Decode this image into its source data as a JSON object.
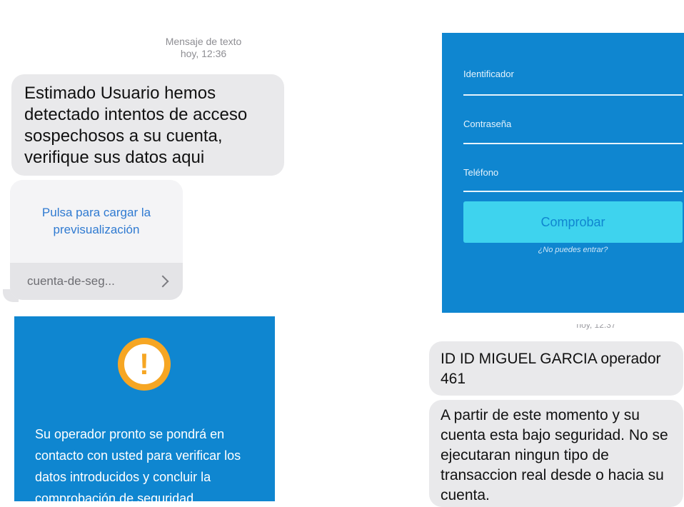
{
  "sms_left": {
    "header_type": "Mensaje de texto",
    "header_time": "hoy, 12:36",
    "message": "Estimado Usuario hemos detectado intentos de acceso sospechosos a su cuenta, verifique sus datos aqui",
    "link_preview": {
      "tap_text": "Pulsa para cargar la previsualización",
      "url": "cuenta-de-seg..."
    }
  },
  "warning_panel": {
    "icon": "exclamation-circle-icon",
    "text": "Su operador pronto se pondrá en contacto con usted para verificar los datos introducidos y concluir la comprobación de seguridad."
  },
  "login_form": {
    "fields": [
      {
        "label": "Identificador"
      },
      {
        "label": "Contraseña"
      },
      {
        "label": "Teléfono"
      }
    ],
    "submit_label": "Comprobar",
    "forgot_link": "¿No puedes entrar?"
  },
  "sms_right": {
    "timestamp": "hoy, 12:37",
    "messages": [
      "ID ID MIGUEL GARCIA operador 461",
      "A partir de este momento y su cuenta esta bajo seguridad. No se ejecutaran ningun tipo de transaccion real desde o hacia su cuenta."
    ]
  },
  "colors": {
    "panel_blue": "#0f86d0",
    "button_cyan": "#3ed3ee",
    "bubble_gray": "#e9e9eb",
    "link_blue": "#2f7ad1",
    "warning_orange": "#f6a623"
  }
}
